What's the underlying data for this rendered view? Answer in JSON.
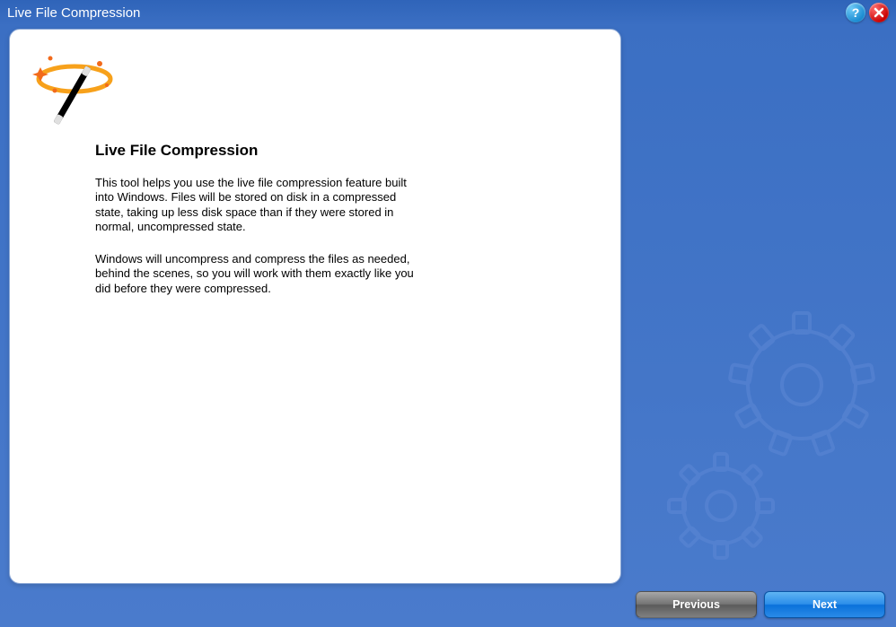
{
  "window": {
    "title": "Live File Compression",
    "help_tooltip": "Help",
    "close_tooltip": "Close"
  },
  "page": {
    "heading": "Live File Compression",
    "paragraph1": "This tool helps you use the live file compression feature built into Windows. Files will be stored on disk in a compressed state, taking up less disk space than if they were stored in normal, uncompressed state.",
    "paragraph2": "Windows will uncompress and compress the files as needed, behind the scenes, so you will work with them exactly like you did before they were compressed."
  },
  "footer": {
    "previous": "Previous",
    "next": "Next"
  },
  "icons": {
    "wand": "magic-wand-icon",
    "help": "?",
    "close": "close-icon",
    "gears": "gears-decoration"
  }
}
